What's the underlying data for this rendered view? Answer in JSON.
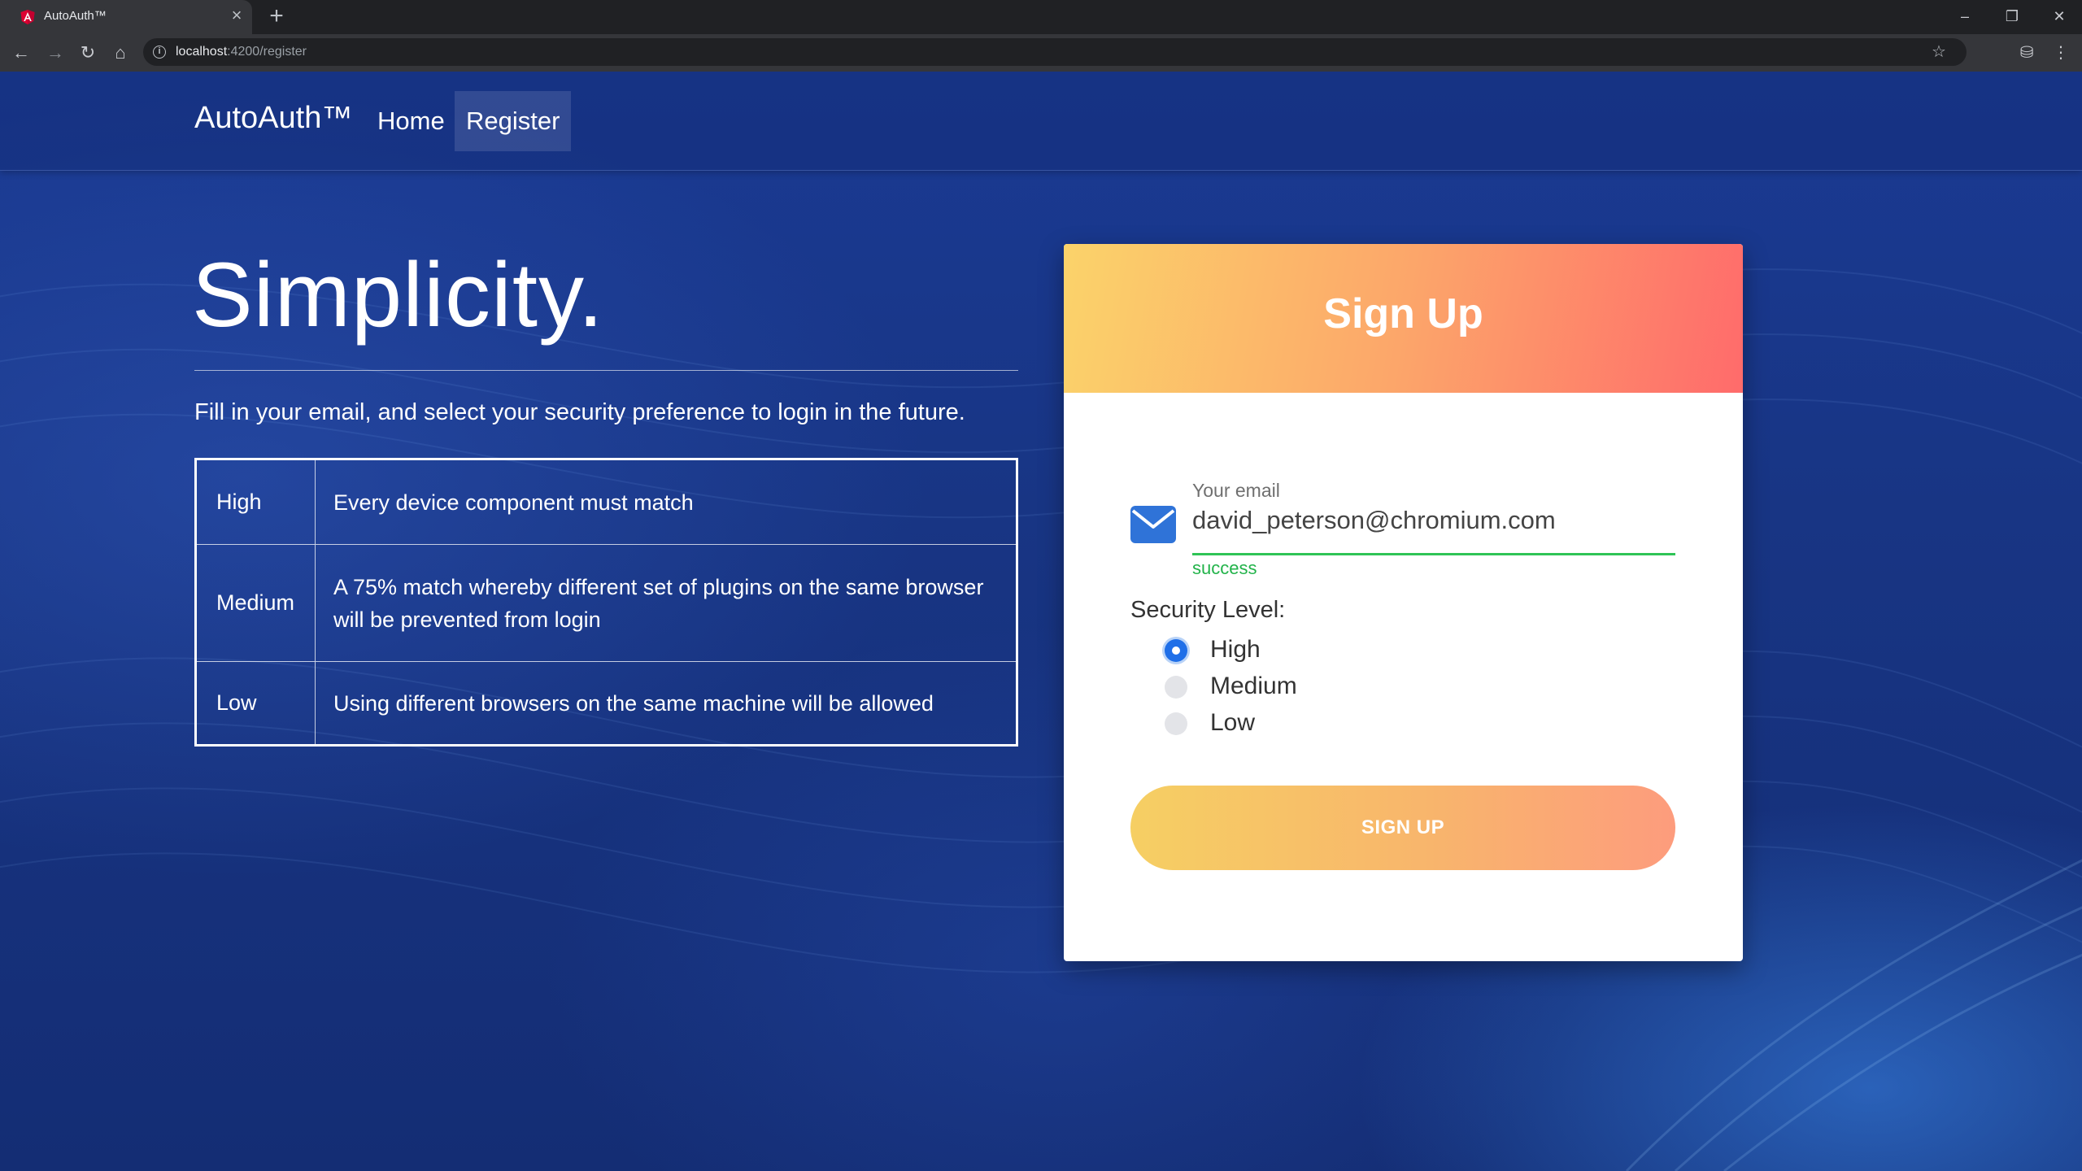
{
  "browser": {
    "tab_title": "AutoAuth™",
    "tab_close": "×",
    "new_tab": "+",
    "url_host": "localhost",
    "url_path": ":4200/register",
    "window": {
      "minimize": "–",
      "restore": "❐",
      "close": "✕"
    },
    "nav": {
      "back": "←",
      "forward": "→",
      "reload": "↻",
      "home": "⌂"
    },
    "bookmark": "☆",
    "incognito": "⛁",
    "menu": "⋮"
  },
  "navbar": {
    "brand": "AutoAuth™",
    "links": [
      {
        "label": "Home",
        "active": false
      },
      {
        "label": "Register",
        "active": true
      }
    ]
  },
  "hero": {
    "title": "Simplicity.",
    "subtitle": "Fill in your email, and select your security preference to login in the future."
  },
  "security_table": [
    {
      "level": "High",
      "description": "Every device component must match"
    },
    {
      "level": "Medium",
      "description": "A 75% match whereby different set of plugins on the same browser will be prevented from login"
    },
    {
      "level": "Low",
      "description": "Using different browsers on the same machine will be allowed"
    }
  ],
  "signup_card": {
    "title": "Sign Up",
    "email_label": "Your email",
    "email_value": "david_peterson@chromium.com",
    "email_status": "success",
    "security_label": "Security Level:",
    "options": [
      {
        "label": "High",
        "checked": true
      },
      {
        "label": "Medium",
        "checked": false
      },
      {
        "label": "Low",
        "checked": false
      }
    ],
    "submit_label": "SIGN UP"
  },
  "colors": {
    "header_gradient": [
      "#fbd36a",
      "#ff6b6b"
    ],
    "button_gradient": [
      "#f6cf63",
      "#fd9c7d"
    ],
    "success": "#22b34a",
    "radio_checked": "#1f6fe8",
    "page_bg": "#16327f"
  }
}
